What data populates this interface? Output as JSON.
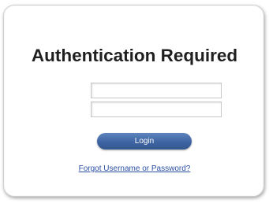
{
  "auth_dialog": {
    "title": "Authentication Required",
    "username_field": {
      "value": "",
      "placeholder": ""
    },
    "password_field": {
      "value": "",
      "placeholder": ""
    },
    "login_button_label": "Login",
    "forgot_link_label": "Forgot Username or Password?"
  },
  "colors": {
    "button_blue": "#3e64a2",
    "link_blue": "#2b4fa3",
    "title_text": "#1f1f1f"
  }
}
